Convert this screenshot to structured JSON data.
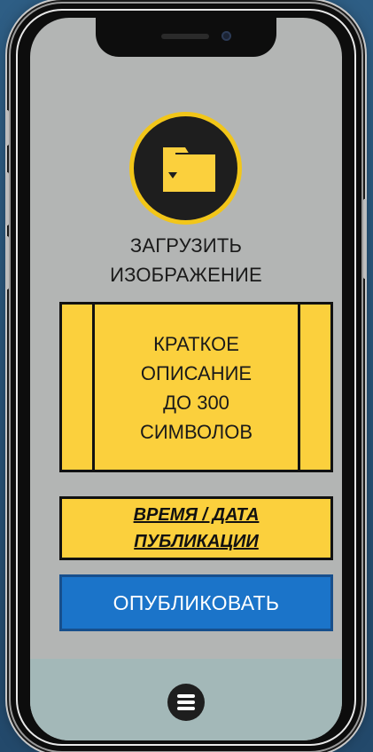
{
  "upload": {
    "icon": "folder-upload-icon",
    "label_line1": "ЗАГРУЗИТЬ",
    "label_line2": "ИЗОБРАЖЕНИЕ"
  },
  "description": {
    "line1": "КРАТКОЕ",
    "line2": "ОПИСАНИЕ",
    "line3": "ДО 300",
    "line4": "СИМВОЛОВ"
  },
  "publish_time": {
    "line1": "ВРЕМЯ / ДАТА",
    "line2": "ПУБЛИКАЦИИ"
  },
  "publish_button": {
    "label": "ОПУБЛИКОВАТЬ"
  },
  "bottom_bar": {
    "menu_icon": "menu-icon"
  },
  "colors": {
    "accent_yellow": "#fbd03d",
    "button_blue": "#1b74c9",
    "screen_gray": "#b3b5b4",
    "bottom_bar": "#a3b8b8"
  }
}
